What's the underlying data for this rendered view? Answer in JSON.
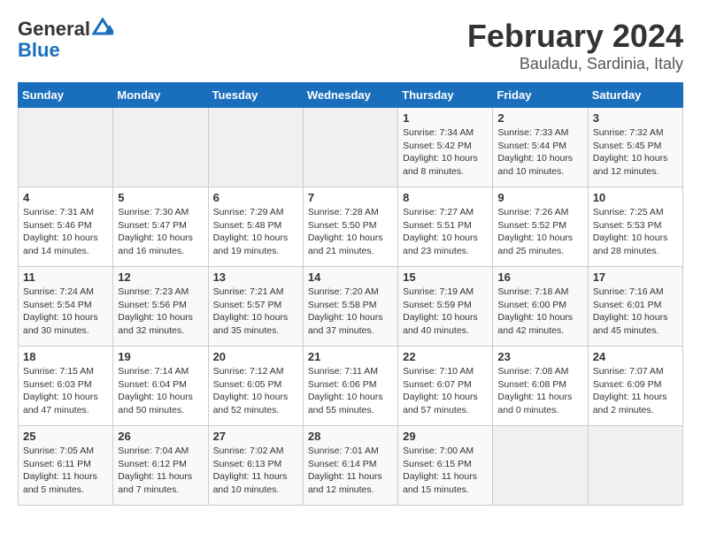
{
  "header": {
    "logo_general": "General",
    "logo_blue": "Blue",
    "title": "February 2024",
    "subtitle": "Bauladu, Sardinia, Italy"
  },
  "days_of_week": [
    "Sunday",
    "Monday",
    "Tuesday",
    "Wednesday",
    "Thursday",
    "Friday",
    "Saturday"
  ],
  "weeks": [
    [
      {
        "num": "",
        "info": "",
        "empty": true
      },
      {
        "num": "",
        "info": "",
        "empty": true
      },
      {
        "num": "",
        "info": "",
        "empty": true
      },
      {
        "num": "",
        "info": "",
        "empty": true
      },
      {
        "num": "1",
        "info": "Sunrise: 7:34 AM\nSunset: 5:42 PM\nDaylight: 10 hours\nand 8 minutes.",
        "empty": false
      },
      {
        "num": "2",
        "info": "Sunrise: 7:33 AM\nSunset: 5:44 PM\nDaylight: 10 hours\nand 10 minutes.",
        "empty": false
      },
      {
        "num": "3",
        "info": "Sunrise: 7:32 AM\nSunset: 5:45 PM\nDaylight: 10 hours\nand 12 minutes.",
        "empty": false
      }
    ],
    [
      {
        "num": "4",
        "info": "Sunrise: 7:31 AM\nSunset: 5:46 PM\nDaylight: 10 hours\nand 14 minutes.",
        "empty": false
      },
      {
        "num": "5",
        "info": "Sunrise: 7:30 AM\nSunset: 5:47 PM\nDaylight: 10 hours\nand 16 minutes.",
        "empty": false
      },
      {
        "num": "6",
        "info": "Sunrise: 7:29 AM\nSunset: 5:48 PM\nDaylight: 10 hours\nand 19 minutes.",
        "empty": false
      },
      {
        "num": "7",
        "info": "Sunrise: 7:28 AM\nSunset: 5:50 PM\nDaylight: 10 hours\nand 21 minutes.",
        "empty": false
      },
      {
        "num": "8",
        "info": "Sunrise: 7:27 AM\nSunset: 5:51 PM\nDaylight: 10 hours\nand 23 minutes.",
        "empty": false
      },
      {
        "num": "9",
        "info": "Sunrise: 7:26 AM\nSunset: 5:52 PM\nDaylight: 10 hours\nand 25 minutes.",
        "empty": false
      },
      {
        "num": "10",
        "info": "Sunrise: 7:25 AM\nSunset: 5:53 PM\nDaylight: 10 hours\nand 28 minutes.",
        "empty": false
      }
    ],
    [
      {
        "num": "11",
        "info": "Sunrise: 7:24 AM\nSunset: 5:54 PM\nDaylight: 10 hours\nand 30 minutes.",
        "empty": false
      },
      {
        "num": "12",
        "info": "Sunrise: 7:23 AM\nSunset: 5:56 PM\nDaylight: 10 hours\nand 32 minutes.",
        "empty": false
      },
      {
        "num": "13",
        "info": "Sunrise: 7:21 AM\nSunset: 5:57 PM\nDaylight: 10 hours\nand 35 minutes.",
        "empty": false
      },
      {
        "num": "14",
        "info": "Sunrise: 7:20 AM\nSunset: 5:58 PM\nDaylight: 10 hours\nand 37 minutes.",
        "empty": false
      },
      {
        "num": "15",
        "info": "Sunrise: 7:19 AM\nSunset: 5:59 PM\nDaylight: 10 hours\nand 40 minutes.",
        "empty": false
      },
      {
        "num": "16",
        "info": "Sunrise: 7:18 AM\nSunset: 6:00 PM\nDaylight: 10 hours\nand 42 minutes.",
        "empty": false
      },
      {
        "num": "17",
        "info": "Sunrise: 7:16 AM\nSunset: 6:01 PM\nDaylight: 10 hours\nand 45 minutes.",
        "empty": false
      }
    ],
    [
      {
        "num": "18",
        "info": "Sunrise: 7:15 AM\nSunset: 6:03 PM\nDaylight: 10 hours\nand 47 minutes.",
        "empty": false
      },
      {
        "num": "19",
        "info": "Sunrise: 7:14 AM\nSunset: 6:04 PM\nDaylight: 10 hours\nand 50 minutes.",
        "empty": false
      },
      {
        "num": "20",
        "info": "Sunrise: 7:12 AM\nSunset: 6:05 PM\nDaylight: 10 hours\nand 52 minutes.",
        "empty": false
      },
      {
        "num": "21",
        "info": "Sunrise: 7:11 AM\nSunset: 6:06 PM\nDaylight: 10 hours\nand 55 minutes.",
        "empty": false
      },
      {
        "num": "22",
        "info": "Sunrise: 7:10 AM\nSunset: 6:07 PM\nDaylight: 10 hours\nand 57 minutes.",
        "empty": false
      },
      {
        "num": "23",
        "info": "Sunrise: 7:08 AM\nSunset: 6:08 PM\nDaylight: 11 hours\nand 0 minutes.",
        "empty": false
      },
      {
        "num": "24",
        "info": "Sunrise: 7:07 AM\nSunset: 6:09 PM\nDaylight: 11 hours\nand 2 minutes.",
        "empty": false
      }
    ],
    [
      {
        "num": "25",
        "info": "Sunrise: 7:05 AM\nSunset: 6:11 PM\nDaylight: 11 hours\nand 5 minutes.",
        "empty": false
      },
      {
        "num": "26",
        "info": "Sunrise: 7:04 AM\nSunset: 6:12 PM\nDaylight: 11 hours\nand 7 minutes.",
        "empty": false
      },
      {
        "num": "27",
        "info": "Sunrise: 7:02 AM\nSunset: 6:13 PM\nDaylight: 11 hours\nand 10 minutes.",
        "empty": false
      },
      {
        "num": "28",
        "info": "Sunrise: 7:01 AM\nSunset: 6:14 PM\nDaylight: 11 hours\nand 12 minutes.",
        "empty": false
      },
      {
        "num": "29",
        "info": "Sunrise: 7:00 AM\nSunset: 6:15 PM\nDaylight: 11 hours\nand 15 minutes.",
        "empty": false
      },
      {
        "num": "",
        "info": "",
        "empty": true
      },
      {
        "num": "",
        "info": "",
        "empty": true
      }
    ]
  ]
}
